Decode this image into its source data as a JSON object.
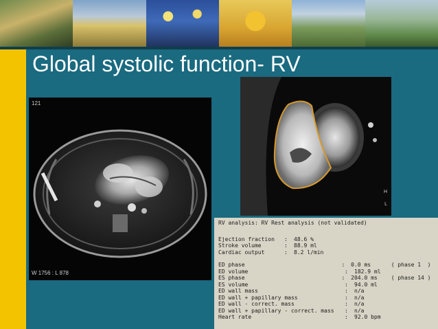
{
  "slide": {
    "title": "Global systolic function- RV"
  },
  "left_image": {
    "frame_number": "121",
    "window_level": "W 1756 : L 878"
  },
  "right_image": {
    "orientation_top": "H",
    "orientation_bottom": "L"
  },
  "report": {
    "heading": "RV analysis: RV Rest analysis (not validated)",
    "summary": [
      {
        "label": "Ejection fraction",
        "value": "48.6 %"
      },
      {
        "label": "Stroke volume",
        "value": "88.9 ml"
      },
      {
        "label": "Cardiac output",
        "value": "8.2 l/min"
      }
    ],
    "details": [
      {
        "label": "ED phase",
        "value": "0.0 ms",
        "extra": "( phase 1  )"
      },
      {
        "label": "ED volume",
        "value": "182.9 ml",
        "extra": ""
      },
      {
        "label": "ES phase",
        "value": "204.0 ms",
        "extra": "( phase 14 )"
      },
      {
        "label": "ES volume",
        "value": "94.0 ml",
        "extra": ""
      },
      {
        "label": "ED wall mass",
        "value": "n/a",
        "extra": ""
      },
      {
        "label": "ED wall + papillary mass",
        "value": "n/a",
        "extra": ""
      },
      {
        "label": "ED wall - correct. mass",
        "value": "n/a",
        "extra": ""
      },
      {
        "label": "ED wall + papillary - correct. mass",
        "value": "n/a",
        "extra": ""
      },
      {
        "label": "Heart rate",
        "value": "92.0 bpm",
        "extra": ""
      }
    ]
  },
  "colors": {
    "background": "#1a6a80",
    "accent_bar": "#f4c300",
    "title_text": "#ffffff",
    "report_bg": "#d8d4c6",
    "contour": "#d89a2a"
  }
}
